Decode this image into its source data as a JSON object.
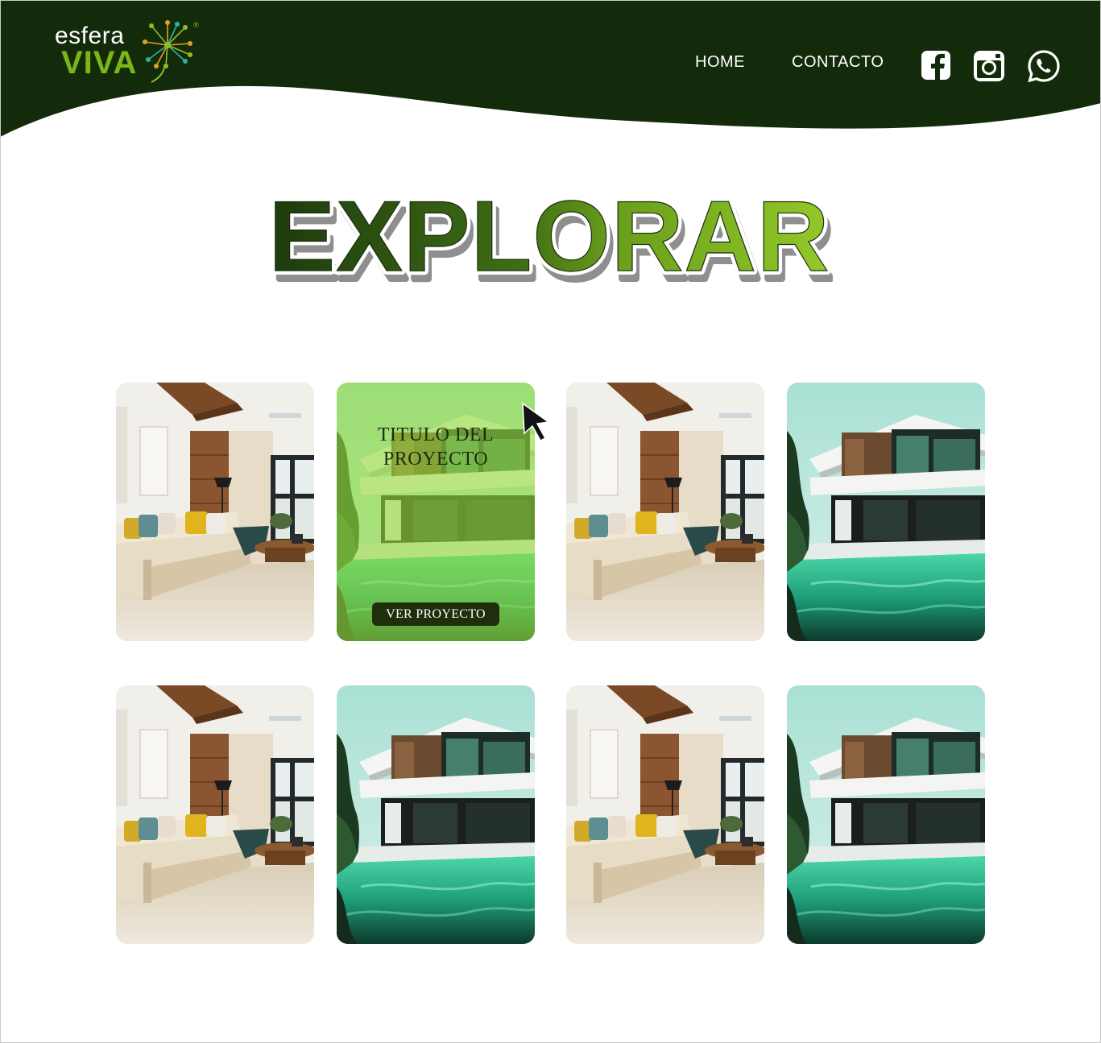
{
  "brand": {
    "name_top": "esfera",
    "name_bottom": "VIVA",
    "registered": "®"
  },
  "nav": {
    "home_label": "HOME",
    "contact_label": "CONTACTO"
  },
  "social": [
    {
      "icon": "facebook-icon"
    },
    {
      "icon": "instagram-icon"
    },
    {
      "icon": "whatsapp-icon"
    }
  ],
  "page_title": "EXPLORAR",
  "colors": {
    "header_bg": "#142b0b",
    "title_dark": "#1d3a0e",
    "title_mid": "#4a7a18",
    "title_light": "#8cbf26",
    "overlay": "#96dc3c",
    "button_bg": "#1f2e0b"
  },
  "hover_card": {
    "title_line1": "TITULO DEL",
    "title_line2": "PROYECTO",
    "button_label": "VER PROYECTO"
  },
  "cards": [
    {
      "image": "living-room"
    },
    {
      "image": "modern-house-pool"
    },
    {
      "image": "living-room"
    },
    {
      "image": "modern-house-pool"
    },
    {
      "image": "living-room"
    },
    {
      "image": "modern-house-pool"
    },
    {
      "image": "living-room"
    },
    {
      "image": "modern-house-pool"
    }
  ]
}
